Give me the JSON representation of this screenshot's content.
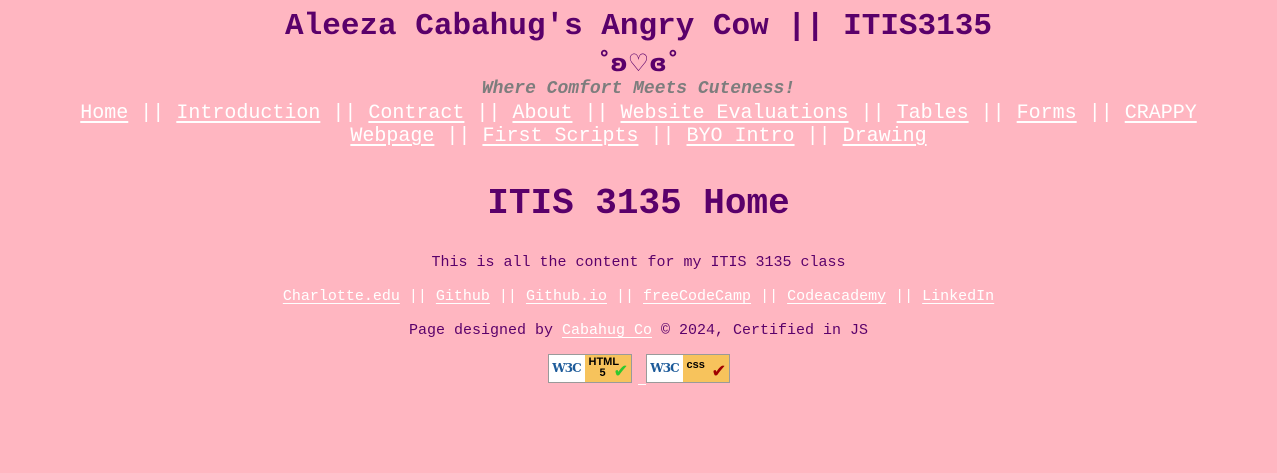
{
  "header": {
    "site_title": "Aleeza Cabahug's Angry Cow || ITIS3135",
    "kaomoji": "˚ʚ♡ɞ˚",
    "tagline": "Where Comfort Meets Cuteness!"
  },
  "nav": {
    "separator": "||",
    "items": [
      {
        "label": "Home"
      },
      {
        "label": "Introduction"
      },
      {
        "label": "Contract"
      },
      {
        "label": "About"
      },
      {
        "label": "Website Evaluations"
      },
      {
        "label": "Tables"
      },
      {
        "label": "Forms"
      },
      {
        "label": "CRAPPY Webpage"
      },
      {
        "label": "First Scripts"
      },
      {
        "label": "BYO Intro"
      },
      {
        "label": "Drawing"
      }
    ]
  },
  "main": {
    "heading": "ITIS 3135 Home",
    "content": "This is all the content for my ITIS 3135 class"
  },
  "footer": {
    "separator": "||",
    "links": [
      {
        "label": "Charlotte.edu"
      },
      {
        "label": "Github"
      },
      {
        "label": "Github.io"
      },
      {
        "label": "freeCodeCamp"
      },
      {
        "label": "Codeacademy"
      },
      {
        "label": "LinkedIn"
      }
    ],
    "credits_prefix": "Page designed by",
    "credits_link": "Cabahug Co",
    "credits_suffix": "© 2024, Certified in JS",
    "badges": [
      {
        "logo": "W3C",
        "kind": "HTML 5",
        "check_color": "#2ec82e",
        "icon": "check-icon"
      },
      {
        "logo": "W3C",
        "kind": "css",
        "check_color": "#a00000",
        "icon": "check-icon"
      }
    ]
  },
  "colors": {
    "background": "#ffb6c1",
    "text": "#5a006a",
    "link": "#ffffff",
    "tagline": "#7d7d7d"
  }
}
